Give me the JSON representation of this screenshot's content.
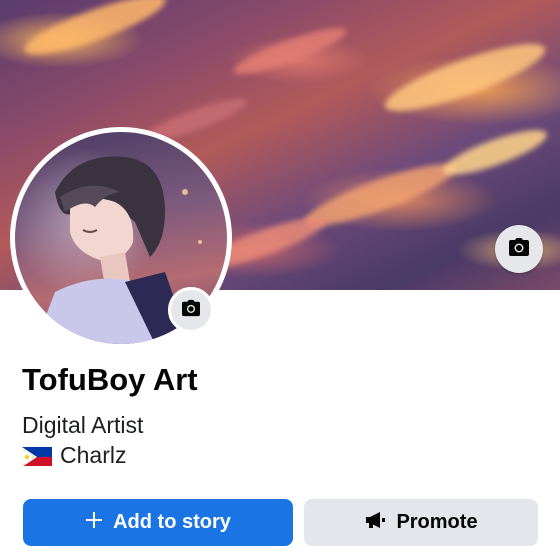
{
  "profile": {
    "name": "TofuBoy Art",
    "category": "Digital Artist",
    "location_name": "Charlz",
    "location_flag_icon": "philippines-flag-icon"
  },
  "actions": {
    "add_story_label": "Add to story",
    "promote_label": "Promote"
  },
  "icons": {
    "cover_camera": "camera-icon",
    "avatar_camera": "camera-icon",
    "add": "plus-icon",
    "promote": "megaphone-icon"
  },
  "colors": {
    "primary": "#1b74e4",
    "secondary_button": "#e4e6eb",
    "camera_button": "#e6e7ea"
  }
}
